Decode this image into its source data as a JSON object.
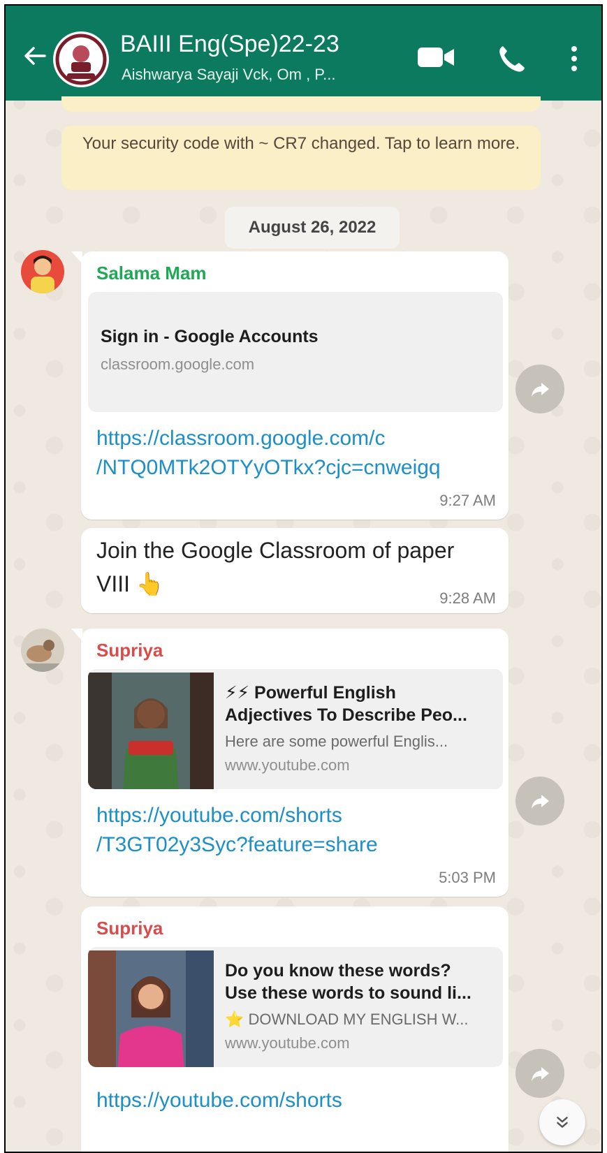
{
  "header": {
    "title": "BAIII Eng(Spe)22-23",
    "subtitle": "Aishwarya Sayaji Vck, Om , P...",
    "bg_color": "#0b7a5f"
  },
  "system_notice": "Your security code with ~ CR7 changed. Tap to learn more.",
  "date_chip": "August 26, 2022",
  "messages": [
    {
      "sender": "Salama Mam",
      "sender_color": "#1fa855",
      "preview": {
        "title": "Sign in - Google Accounts",
        "domain": "classroom.google.com"
      },
      "link_line1": "https://classroom.google.com/c",
      "link_line2": "/NTQ0MTk2OTYyOTkx?cjc=cnweigq",
      "time": "9:27 AM"
    },
    {
      "text_line1": "Join the Google Classroom of paper",
      "text_line2": "VIII",
      "emoji": "👆",
      "time": "9:28 AM"
    },
    {
      "sender": "Supriya",
      "sender_color": "#d94c4c",
      "preview": {
        "title_line1": "⚡⚡ Powerful English",
        "title_line2": "Adjectives To Describe Peo...",
        "desc": "Here are some powerful Englis...",
        "domain": "www.youtube.com"
      },
      "link_line1": "https://youtube.com/shorts",
      "link_line2": "/T3GT02y3Syc?feature=share",
      "time": "5:03 PM"
    },
    {
      "sender": "Supriya",
      "sender_color": "#d94c4c",
      "preview": {
        "title_line1": "Do you know these words?",
        "title_line2": "Use these words to sound li...",
        "desc": "⭐ DOWNLOAD MY ENGLISH W...",
        "domain": "www.youtube.com"
      },
      "link_line1": "https://youtube.com/shorts"
    }
  ],
  "icons": [
    "back-arrow-icon",
    "video-call-icon",
    "phone-icon",
    "more-vert-icon",
    "forward-icon",
    "scroll-down-icon"
  ]
}
